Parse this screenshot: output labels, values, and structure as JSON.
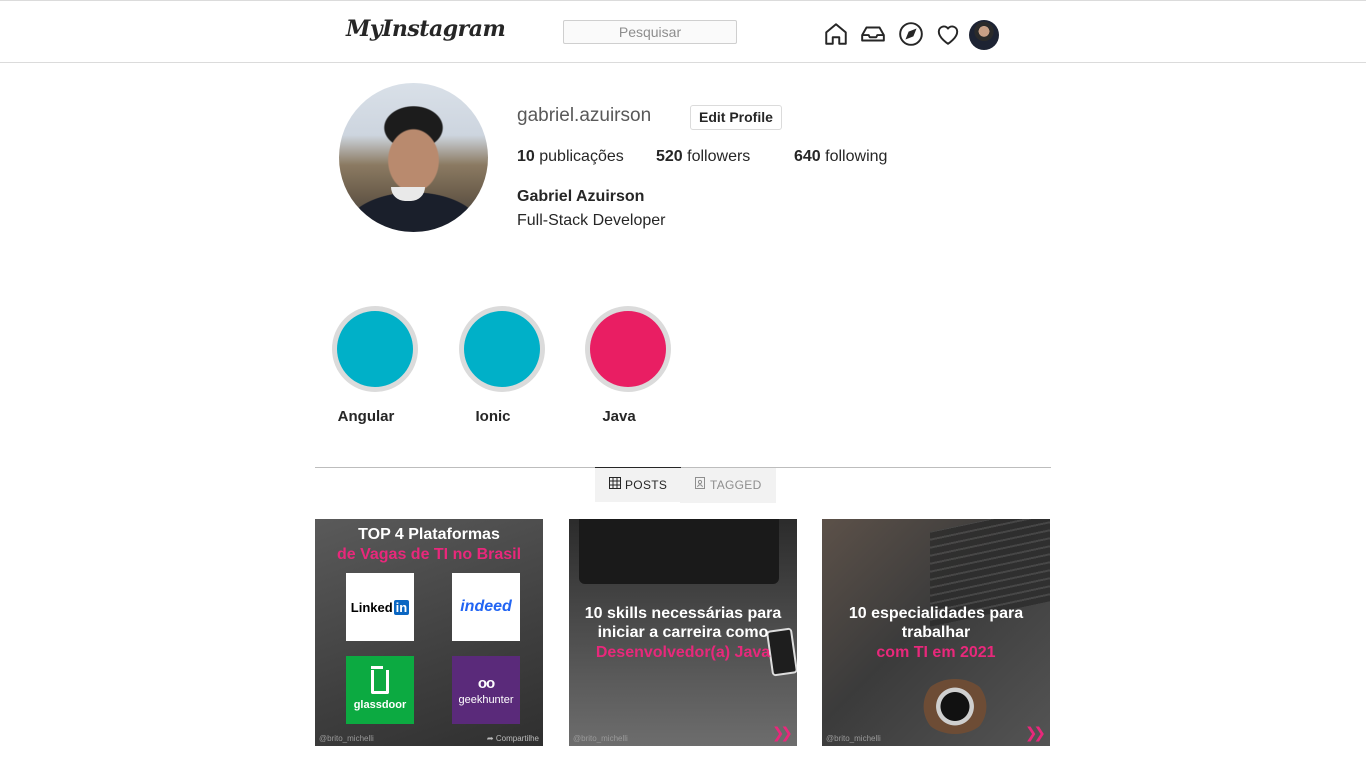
{
  "nav": {
    "logo": "MyInstagram",
    "search_placeholder": "Pesquisar",
    "icons": [
      "home-icon",
      "inbox-icon",
      "explore-icon",
      "activity-heart-icon",
      "profile-avatar"
    ]
  },
  "profile": {
    "username": "gabriel.azuirson",
    "edit_label": "Edit Profile",
    "stats": [
      {
        "count": "10",
        "label": "publicações"
      },
      {
        "count": "520",
        "label": "followers"
      },
      {
        "count": "640",
        "label": "following"
      }
    ],
    "full_name": "Gabriel Azuirson",
    "bio": "Full-Stack Developer"
  },
  "highlights": [
    {
      "label": "Angular",
      "color": "#00b0c8"
    },
    {
      "label": "Ionic",
      "color": "#00b0c8"
    },
    {
      "label": "Java",
      "color": "#e91e63"
    }
  ],
  "tabs": [
    {
      "label": "POSTS",
      "icon": "grid-icon",
      "active": true
    },
    {
      "label": "TAGGED",
      "icon": "tagged-icon",
      "active": false
    }
  ],
  "posts": [
    {
      "title": "TOP 4  Plataformas",
      "subtitle": "de Vagas  de TI no Brasil",
      "logos": {
        "linkedin": "Linked",
        "linkedin_in": "in",
        "indeed": "indeed",
        "glassdoor": "glassdoor",
        "geekhunter": "geekhunter",
        "geek_glasses": "oo"
      },
      "watermark": "@brito_michelli",
      "share": "Compartilhe"
    },
    {
      "title_lines": [
        "10 skills necessárias para",
        "iniciar a carreira como"
      ],
      "subtitle": "Desenvolvedor(a) Java",
      "watermark": "@brito_michelli"
    },
    {
      "title_lines": [
        "10 especialidades para",
        "trabalhar"
      ],
      "subtitle": "com TI em 2021",
      "watermark": "@brito_michelli"
    }
  ],
  "colors": {
    "accent_pink": "#e8287b",
    "teal": "#00b0c8",
    "linkedin_blue": "#0a66c2",
    "indeed_blue": "#2164f3",
    "glassdoor_green": "#0caa41",
    "geekhunter_purple": "#5a2a7a"
  }
}
